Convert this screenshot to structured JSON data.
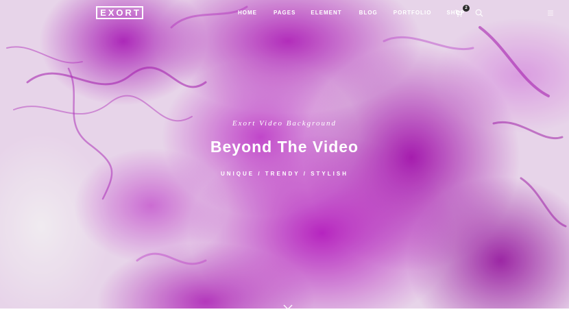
{
  "brand": {
    "logo_text": "EXORT"
  },
  "nav": {
    "items": [
      {
        "label": "HOME"
      },
      {
        "label": "PAGES"
      },
      {
        "label": "ELEMENT"
      },
      {
        "label": "BLOG"
      },
      {
        "label": "PORTFOLIO"
      },
      {
        "label": "SHOP"
      }
    ]
  },
  "header_icons": {
    "cart": {
      "icon": "cart-icon",
      "count": "2"
    },
    "search": {
      "icon": "search-icon"
    },
    "menu": {
      "icon": "menu-icon"
    }
  },
  "hero": {
    "subtitle": "Exort Video Background",
    "headline": "Beyond The Video",
    "tagline": "UNIQUE / TRENDY / STYLISH",
    "scroll_icon": "chevron-down-icon",
    "accent_color": "#b41ec0"
  }
}
